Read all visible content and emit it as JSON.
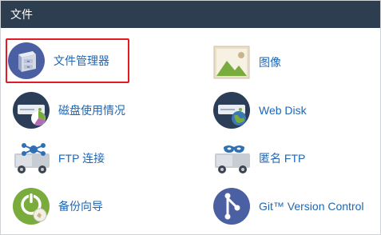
{
  "section": {
    "title": "文件"
  },
  "tools": {
    "file_manager": {
      "label": "文件管理器",
      "icon": "file-cabinet-icon"
    },
    "images": {
      "label": "图像",
      "icon": "image-icon"
    },
    "disk_usage": {
      "label": "磁盘使用情况",
      "icon": "disk-usage-icon"
    },
    "web_disk": {
      "label": "Web Disk",
      "icon": "web-disk-icon"
    },
    "ftp_connections": {
      "label": "FTP 连接",
      "icon": "ftp-connections-icon"
    },
    "anonymous_ftp": {
      "label": "匿名 FTP",
      "icon": "anonymous-ftp-icon"
    },
    "backup_wizard": {
      "label": "备份向导",
      "icon": "backup-wizard-icon"
    },
    "git_version_control": {
      "label": "Git™ Version Control",
      "icon": "git-icon"
    }
  },
  "colors": {
    "header_bg": "#2c3e50",
    "link": "#1f66b3",
    "highlight_border": "#e21b24",
    "icon_blue": "#4b5fa3",
    "icon_green": "#7aab3d",
    "icon_navy": "#2b3d57"
  }
}
